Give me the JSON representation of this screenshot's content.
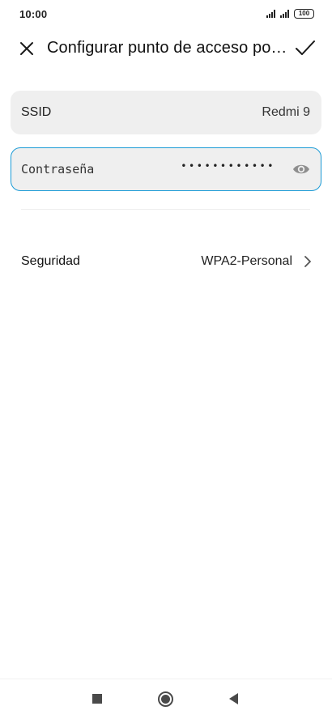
{
  "status_bar": {
    "time": "10:00",
    "battery": "100",
    "icons": [
      "signal-icon",
      "signal-icon",
      "battery-icon"
    ]
  },
  "header": {
    "title": "Configurar punto de acceso po…",
    "close_icon": "close-icon",
    "confirm_icon": "check-icon"
  },
  "form": {
    "ssid": {
      "label": "SSID",
      "value": "Redmi 9"
    },
    "password": {
      "placeholder": "Contraseña",
      "masked_value": "••••••••••••",
      "visibility_icon": "eye-icon"
    },
    "security": {
      "label": "Seguridad",
      "value": "WPA2-Personal",
      "chevron_icon": "chevron-right-icon"
    }
  },
  "colors": {
    "accent": "#1b9bd6",
    "field_background": "#efefef",
    "text": "#1a1a1a"
  },
  "nav_bar": {
    "icons": [
      "recents-icon",
      "home-icon",
      "back-icon"
    ]
  }
}
